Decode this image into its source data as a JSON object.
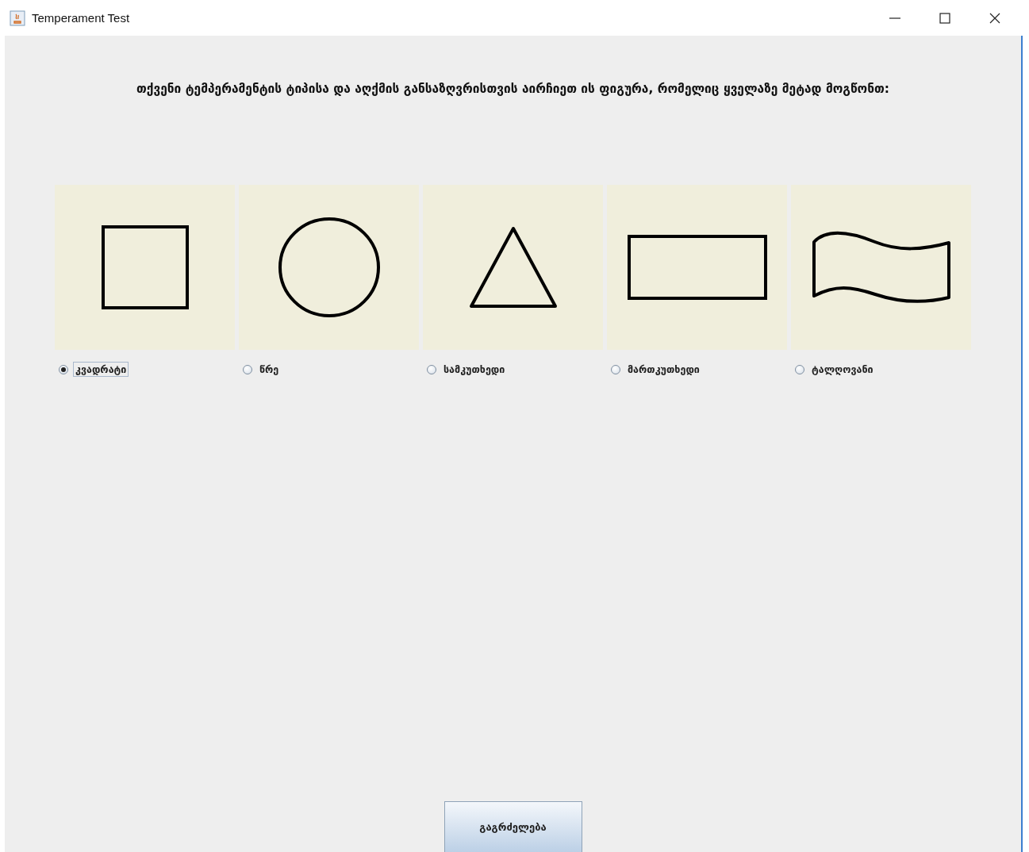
{
  "window": {
    "title": "Temperament Test"
  },
  "prompt": "თქვენი ტემპერამენტის ტიპისა და აღქმის განსაზღვრისთვის აირჩიეთ ის ფიგურა, რომელიც ყველაზე მეტად მოგწონთ:",
  "options": [
    {
      "kind": "square",
      "label": "კვადრატი",
      "selected": true
    },
    {
      "kind": "circle",
      "label": "წრე",
      "selected": false
    },
    {
      "kind": "triangle",
      "label": "სამკუთხედი",
      "selected": false
    },
    {
      "kind": "rectangle",
      "label": "მართკუთხედი",
      "selected": false
    },
    {
      "kind": "wave",
      "label": "ტალღოვანი",
      "selected": false
    }
  ],
  "continue_button": "გაგრძელება"
}
